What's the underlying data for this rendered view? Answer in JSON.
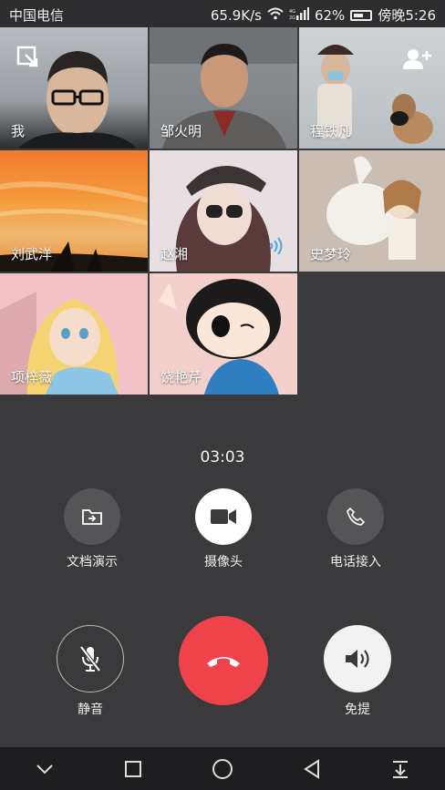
{
  "status": {
    "carrier": "中国电信",
    "speed": "65.9K/s",
    "battery": "62%",
    "time": "傍晚5:26"
  },
  "participants": [
    {
      "name": "我"
    },
    {
      "name": "邹火明"
    },
    {
      "name": "程铁凡"
    },
    {
      "name": "刘武洋"
    },
    {
      "name": "赵湘"
    },
    {
      "name": "史梦玲"
    },
    {
      "name": "项梓薇"
    },
    {
      "name": "饶艳芹"
    }
  ],
  "call": {
    "timer": "03:03"
  },
  "controls": {
    "doc_share": "文档演示",
    "camera": "摄像头",
    "phone_in": "电话接入",
    "mute": "静音",
    "speaker": "免提"
  },
  "colors": {
    "hangup": "#f0424a",
    "background": "#3a3a3c"
  }
}
